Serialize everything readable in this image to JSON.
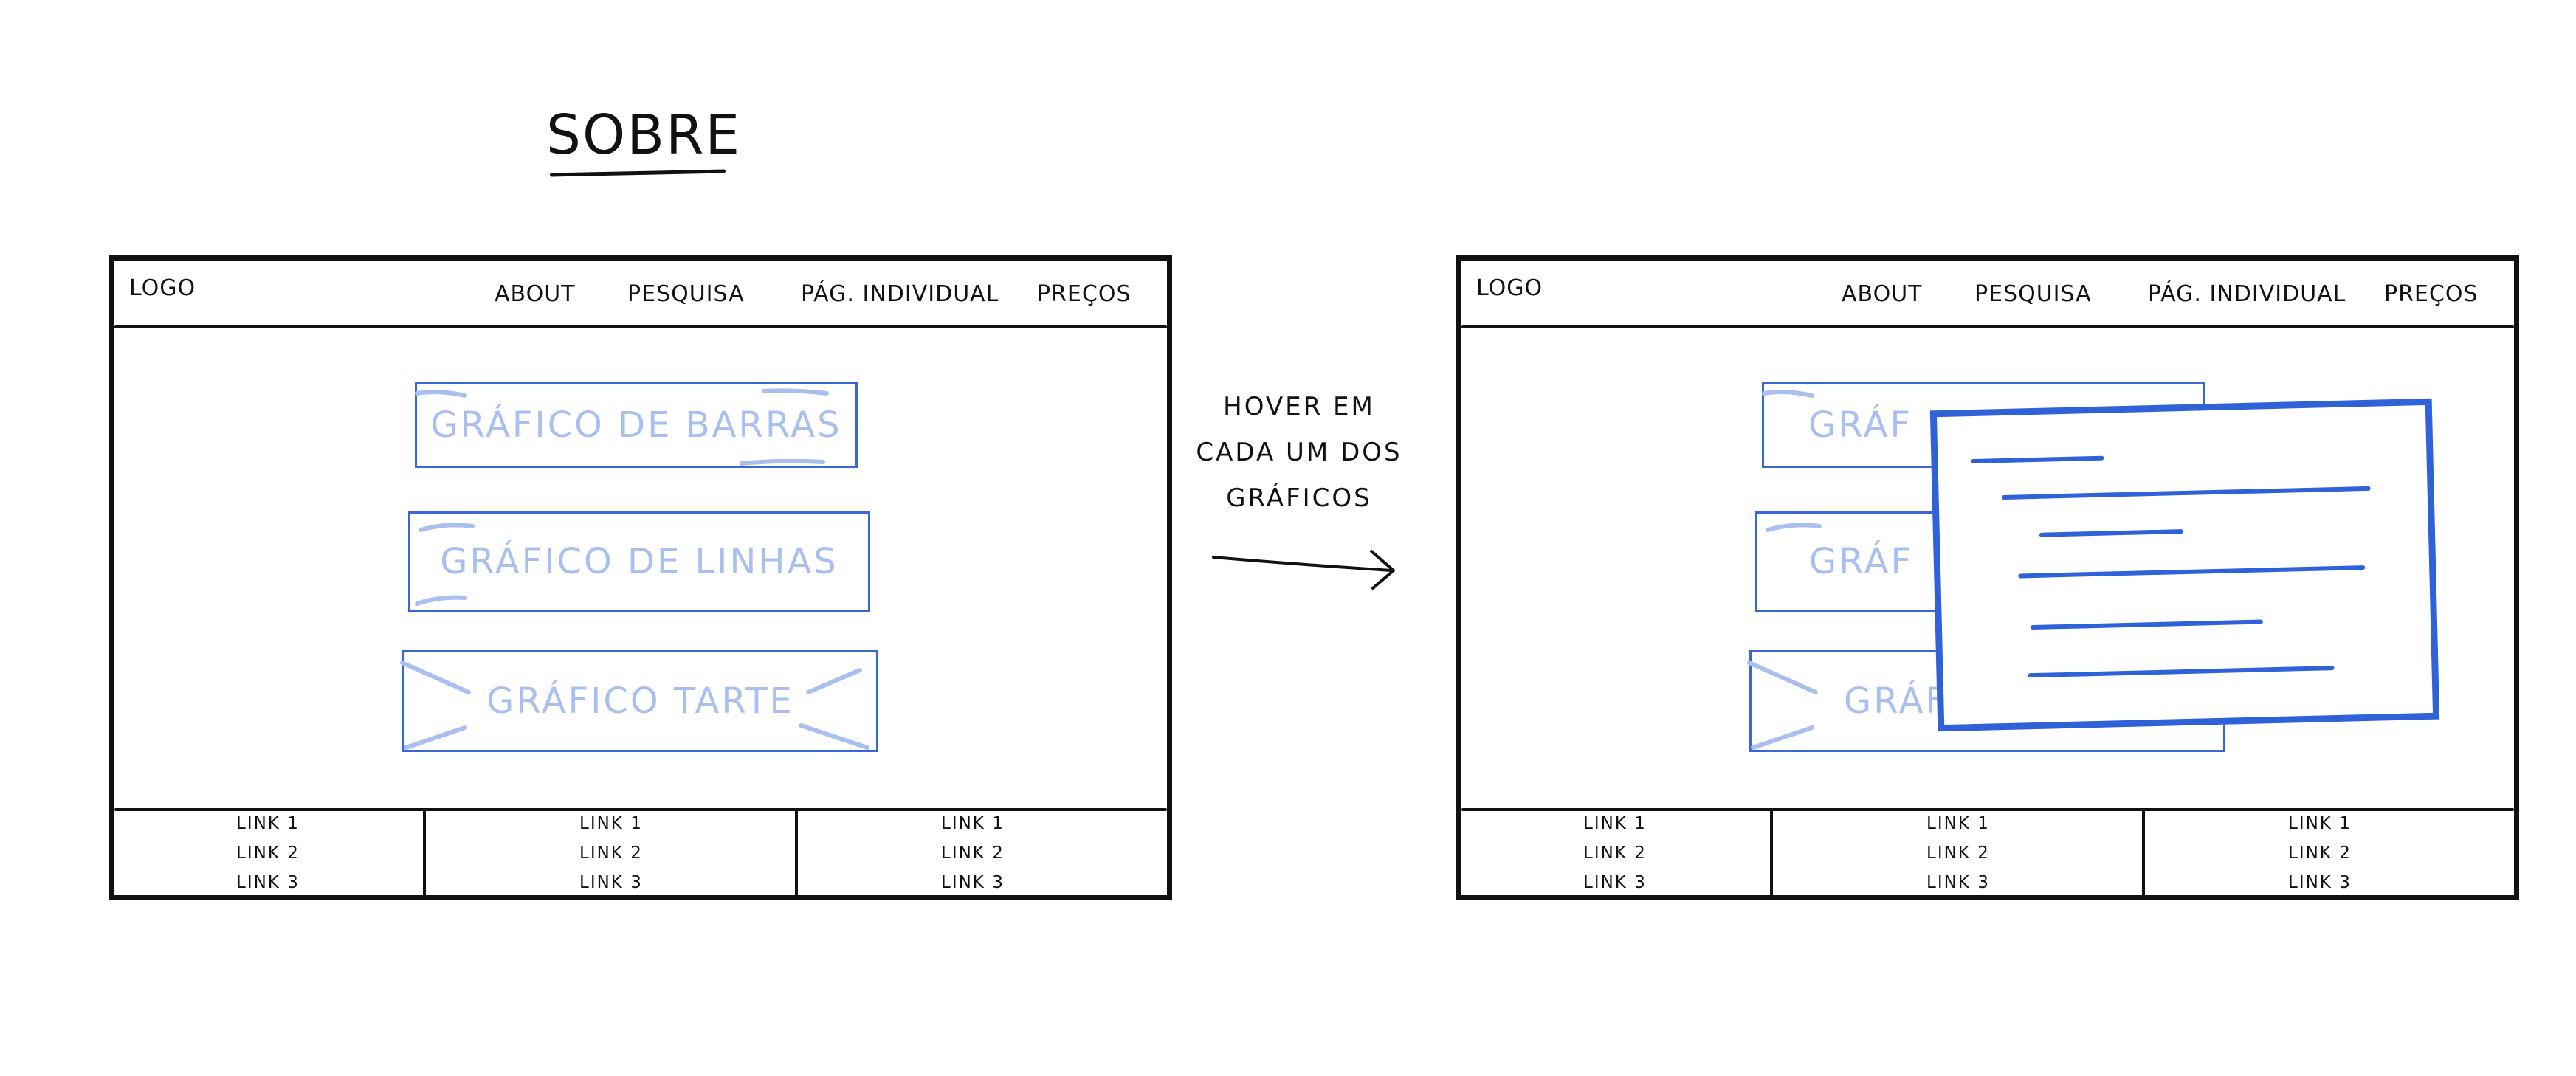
{
  "page_title": "SOBRE",
  "note": {
    "lines": [
      "HOVER EM",
      "CADA UM DOS",
      "GRÁFICOS"
    ]
  },
  "wireframe": {
    "logo": "LOGO",
    "nav": [
      "ABOUT",
      "PESQUISA",
      "PÁG. INDIVIDUAL",
      "PREÇOS"
    ],
    "graphs": [
      "GRÁFICO DE BARRAS",
      "GRÁFICO DE LINHAS",
      "GRÁFICO TARTE"
    ],
    "graphs_partial": [
      "GRÁF",
      "GRÁF",
      "GRÁF"
    ],
    "footer_columns": [
      [
        "LINK 1",
        "LINK 2",
        "LINK 3"
      ],
      [
        "LINK 1",
        "LINK 2",
        "LINK 3"
      ],
      [
        "LINK 1",
        "LINK 2",
        "LINK 3"
      ]
    ]
  },
  "colors": {
    "ink": "#111111",
    "accent": "#2f62d8",
    "accent_light": "#a9bff0"
  },
  "icons": {
    "arrow": "right-arrow-icon"
  }
}
